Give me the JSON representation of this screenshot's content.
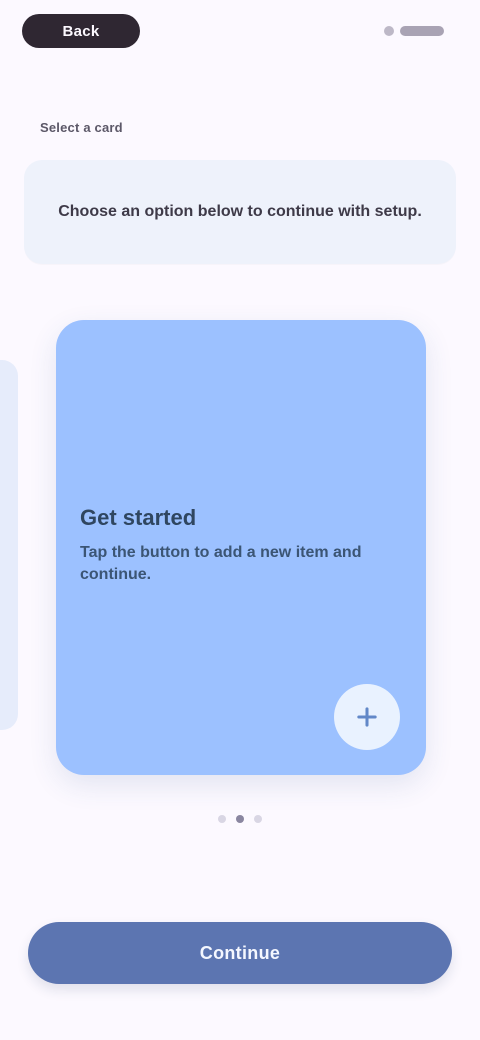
{
  "topbar": {
    "back_label": "Back",
    "right_text": ""
  },
  "section": {
    "label": "Select a card"
  },
  "info": {
    "text": "Choose an option below to continue with setup."
  },
  "card": {
    "title": "Get started",
    "description": "Tap the button to add a new item and continue."
  },
  "pager": {
    "active_index": 1,
    "count": 3
  },
  "actions": {
    "primary_label": "Continue"
  },
  "colors": {
    "background": "#fcf9ff",
    "card_blue": "#9cc1ff",
    "primary": "#5c75b1",
    "dark_pill": "#2f2732"
  },
  "icons": {
    "fab": "plus-icon",
    "pager_dot": "pager-dot-icon"
  }
}
